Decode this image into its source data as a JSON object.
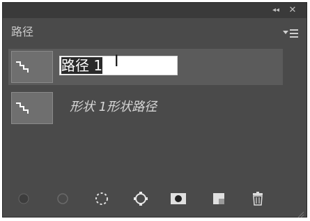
{
  "window": {
    "collapse_glyph": "◂◂",
    "close_glyph": "✕"
  },
  "panel": {
    "tab_label": "路径",
    "menu_icon": "panel-menu-icon"
  },
  "paths": [
    {
      "thumbnail_icon": "path-thumbnail-icon",
      "name_selected": "路径 1",
      "editing": true
    },
    {
      "thumbnail_icon": "path-thumbnail-icon",
      "name": "形状 1形状路径",
      "editing": false
    }
  ],
  "toolbar": [
    {
      "name": "fill-path-icon"
    },
    {
      "name": "stroke-path-icon"
    },
    {
      "name": "load-as-selection-icon"
    },
    {
      "name": "make-work-path-icon"
    },
    {
      "name": "add-mask-icon"
    },
    {
      "name": "new-path-icon"
    },
    {
      "name": "delete-path-icon"
    }
  ],
  "colors": {
    "panel_bg": "#4a4a4a",
    "selected_row_bg": "#5b5b5b",
    "text": "#c8c8c8"
  }
}
